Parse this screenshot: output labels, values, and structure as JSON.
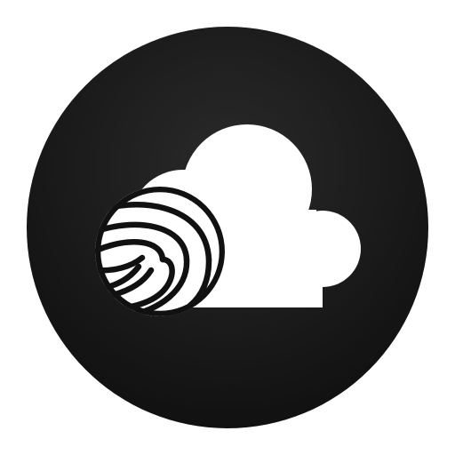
{
  "app_icon": {
    "name": "cloud-fingerprint-app-icon",
    "icon_parts": [
      "circle-background",
      "cloud-icon",
      "fingerprint-icon"
    ],
    "colors": {
      "background_outer": "#0f0f0f",
      "background_inner": "#2a2a2a",
      "foreground": "#ffffff",
      "fingerprint_lines": "#111111"
    }
  }
}
